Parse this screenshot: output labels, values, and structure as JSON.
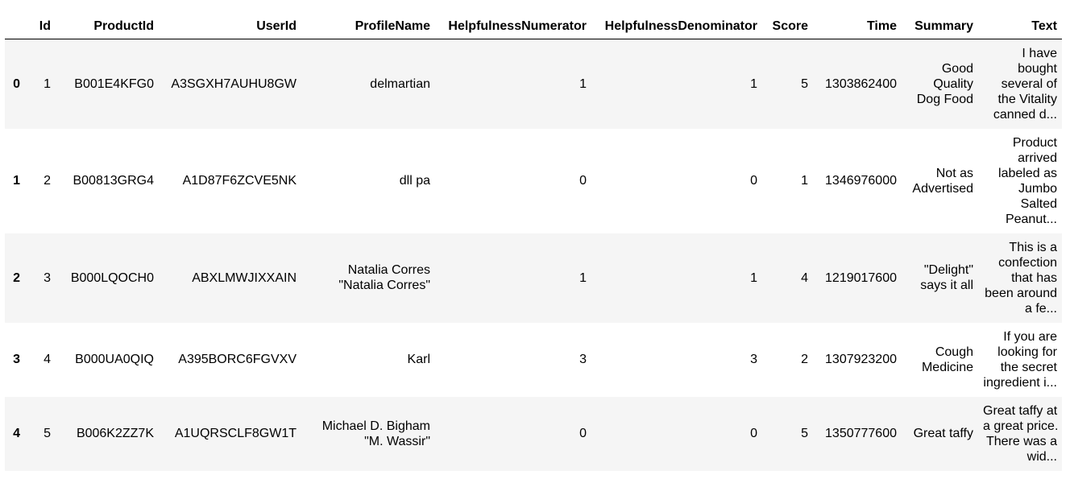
{
  "table": {
    "columns": [
      "",
      "Id",
      "ProductId",
      "UserId",
      "ProfileName",
      "HelpfulnessNumerator",
      "HelpfulnessDenominator",
      "Score",
      "Time",
      "Summary",
      "Text"
    ],
    "rows": [
      {
        "index": "0",
        "id": "1",
        "product_id": "B001E4KFG0",
        "user_id": "A3SGXH7AUHU8GW",
        "profile_name": [
          "delmartian"
        ],
        "helpfulness_numerator": "1",
        "helpfulness_denominator": "1",
        "score": "5",
        "time": "1303862400",
        "summary": [
          "Good",
          "Quality",
          "Dog Food"
        ],
        "text": [
          "I have",
          "bought",
          "several of",
          "the Vitality",
          "canned d..."
        ]
      },
      {
        "index": "1",
        "id": "2",
        "product_id": "B00813GRG4",
        "user_id": "A1D87F6ZCVE5NK",
        "profile_name": [
          "dll pa"
        ],
        "helpfulness_numerator": "0",
        "helpfulness_denominator": "0",
        "score": "1",
        "time": "1346976000",
        "summary": [
          "Not as",
          "Advertised"
        ],
        "text": [
          "Product",
          "arrived",
          "labeled as",
          "Jumbo",
          "Salted",
          "Peanut..."
        ]
      },
      {
        "index": "2",
        "id": "3",
        "product_id": "B000LQOCH0",
        "user_id": "ABXLMWJIXXAIN",
        "profile_name": [
          "Natalia Corres",
          "\"Natalia Corres\""
        ],
        "helpfulness_numerator": "1",
        "helpfulness_denominator": "1",
        "score": "4",
        "time": "1219017600",
        "summary": [
          "\"Delight\"",
          "says it all"
        ],
        "text": [
          "This is a",
          "confection",
          "that has",
          "been around",
          "a fe..."
        ]
      },
      {
        "index": "3",
        "id": "4",
        "product_id": "B000UA0QIQ",
        "user_id": "A395BORC6FGVXV",
        "profile_name": [
          "Karl"
        ],
        "helpfulness_numerator": "3",
        "helpfulness_denominator": "3",
        "score": "2",
        "time": "1307923200",
        "summary": [
          "Cough",
          "Medicine"
        ],
        "text": [
          "If you are",
          "looking for",
          "the secret",
          "ingredient i..."
        ]
      },
      {
        "index": "4",
        "id": "5",
        "product_id": "B006K2ZZ7K",
        "user_id": "A1UQRSCLF8GW1T",
        "profile_name": [
          "Michael D. Bigham",
          "\"M. Wassir\""
        ],
        "helpfulness_numerator": "0",
        "helpfulness_denominator": "0",
        "score": "5",
        "time": "1350777600",
        "summary": [
          "Great taffy"
        ],
        "text": [
          "Great taffy at",
          "a great price.",
          "There was a",
          "wid..."
        ]
      }
    ]
  }
}
